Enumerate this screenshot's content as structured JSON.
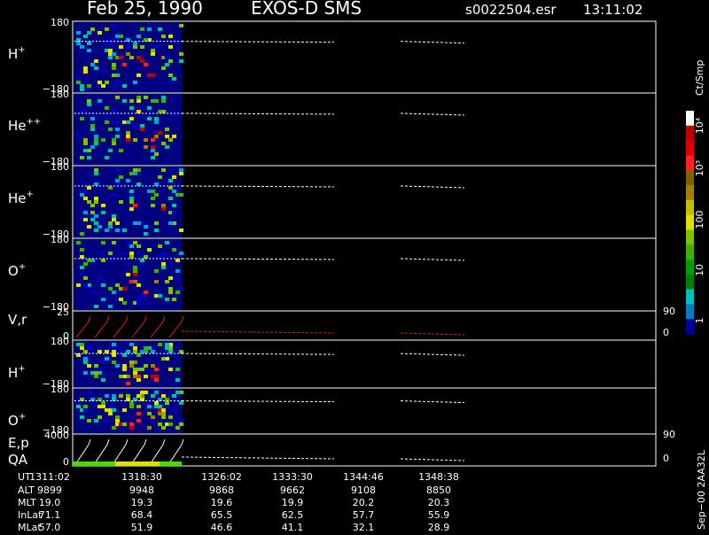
{
  "header": {
    "date": "Feb 25, 1990",
    "instrument": "EXOS-D SMS",
    "file": "s0022504.esr",
    "time": "13:11:02"
  },
  "panels": [
    {
      "id": "h1",
      "label": "H",
      "sup": "+",
      "ymax": "180",
      "ymin": "−180"
    },
    {
      "id": "he2",
      "label": "He",
      "sup": "++",
      "ymax": "180",
      "ymin": "−180"
    },
    {
      "id": "he1",
      "label": "He",
      "sup": "+",
      "ymax": "180",
      "ymin": "−180"
    },
    {
      "id": "o1",
      "label": "O",
      "sup": "+",
      "ymax": "180",
      "ymin": "−180"
    },
    {
      "id": "vr",
      "label": "V,r",
      "sup": "",
      "ymax": "25",
      "ymin": "0",
      "rmax": "90",
      "rmin": "0"
    },
    {
      "id": "h2",
      "label": "H",
      "sup": "+",
      "ymax": "180",
      "ymin": "−180"
    },
    {
      "id": "o2",
      "label": "O",
      "sup": "+",
      "ymax": "180",
      "ymin": "−180"
    },
    {
      "id": "ep",
      "label": "E,p",
      "label2": "QA",
      "sup": "",
      "ymax": "4000",
      "ymin": "0",
      "rmax": "90",
      "rmin": "0"
    }
  ],
  "colorbar": {
    "unit": "Ct/Smp",
    "labels": [
      "10⁴",
      "10³",
      "100",
      "10",
      "1"
    ],
    "colors": [
      "#ffffff",
      "#c00000",
      "#e00000",
      "#ff2020",
      "#806000",
      "#a08000",
      "#c0c000",
      "#e0e000",
      "#80c000",
      "#40b000",
      "#00a000",
      "#008000",
      "#00c0c0",
      "#0080c0",
      "#0000a0"
    ]
  },
  "side_label": "Sep−00 2AA32L",
  "chart_data": {
    "type": "table",
    "row_labels": [
      "UT",
      "ALT",
      "MLT",
      "InLat",
      "MLat"
    ],
    "columns": [
      [
        "1311:02",
        "9899",
        "19.0",
        "71.1",
        "57.0"
      ],
      [
        "1318:30",
        "9948",
        "19.3",
        "68.4",
        "51.9"
      ],
      [
        "1326:02",
        "9868",
        "19.6",
        "65.5",
        "46.6"
      ],
      [
        "1333:30",
        "9662",
        "19.9",
        "62.5",
        "41.1"
      ],
      [
        "1344:46",
        "9108",
        "20.2",
        "57.7",
        "32.1"
      ],
      [
        "1348:38",
        "8850",
        "20.3",
        "55.9",
        "28.9"
      ]
    ]
  }
}
